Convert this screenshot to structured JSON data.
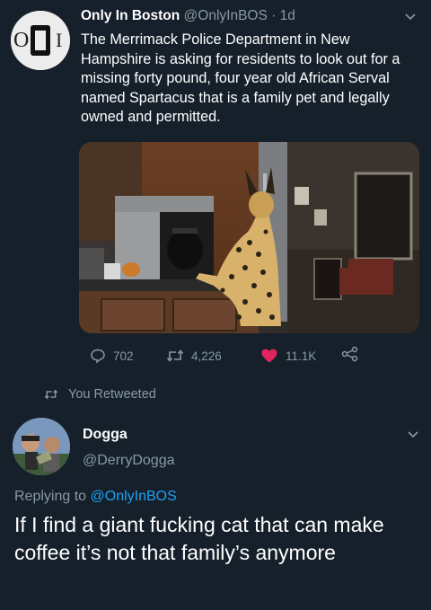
{
  "tweet": {
    "author_name": "Only In Boston",
    "author_handle": "@OnlyInBOS",
    "separator": "·",
    "time": "1d",
    "avatar_text": "OIB",
    "text": "The Merrimack Police Department in New Hampshire is asking for residents to look out for a missing forty pound, four year old African Serval named Spartacus that is a family pet and legally owned and permitted.",
    "stats": {
      "replies": "702",
      "retweets": "4,226",
      "likes": "11.1K"
    }
  },
  "retweet_notice": "You Retweeted",
  "reply": {
    "author_name": "Dogga",
    "author_handle": "@DerryDogga",
    "replying_to_label": "Replying to",
    "replying_to_handle": "@OnlyInBOS",
    "text": "If I find a giant fucking cat that can make coffee it’s not that family’s anymore"
  },
  "colors": {
    "background": "#15202b",
    "muted": "#8899a6",
    "link": "#1da1f2",
    "like": "#e0245e"
  }
}
